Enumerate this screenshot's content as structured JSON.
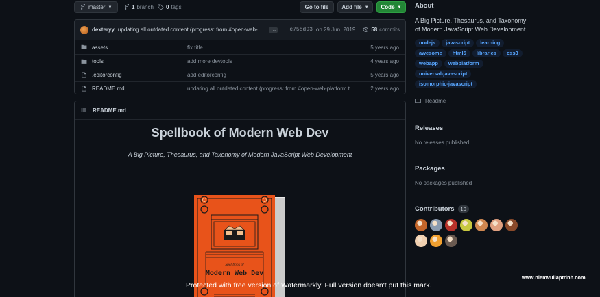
{
  "toolbar": {
    "branch": "master",
    "branch_count": "1",
    "branch_word": "branch",
    "tag_count": "0",
    "tag_word": "tags",
    "goto_file": "Go to file",
    "add_file": "Add file",
    "code": "Code"
  },
  "commit": {
    "author": "dexteryy",
    "message": "updating all outdated content (progress: from #open-web-platfo...",
    "ellipsis": "…",
    "sha": "e758d93",
    "date": "on 29 Jun, 2019",
    "count": "58",
    "count_label": "commits"
  },
  "files": [
    {
      "name": "assets",
      "type": "folder",
      "message": "fix title",
      "age": "5 years ago"
    },
    {
      "name": "tools",
      "type": "folder",
      "message": "add more devtools",
      "age": "4 years ago"
    },
    {
      "name": ".editorconfig",
      "type": "file",
      "message": "add editorconfig",
      "age": "5 years ago"
    },
    {
      "name": "README.md",
      "type": "file",
      "message": "updating all outdated content (progress: from #open-web-platform t...",
      "age": "2 years ago"
    }
  ],
  "readme": {
    "filename": "README.md",
    "heading": "Spellbook of Modern Web Dev",
    "subtitle": "A Big Picture, Thesaurus, and Taxonomy of Modern JavaScript Web Development",
    "book_small": "Spellbook of",
    "book_title": "Modern Web Dev"
  },
  "about": {
    "heading": "About",
    "description": "A Big Picture, Thesaurus, and Taxonomy of Modern JavaScript Web Development",
    "topics": [
      "nodejs",
      "javascript",
      "learning",
      "awesome",
      "html5",
      "libraries",
      "css3",
      "webapp",
      "webplatform",
      "universal-javascript",
      "isomorphic-javascript"
    ],
    "readme_link": "Readme"
  },
  "releases": {
    "heading": "Releases",
    "empty": "No releases published"
  },
  "packages": {
    "heading": "Packages",
    "empty": "No packages published"
  },
  "contributors": {
    "heading": "Contributors",
    "count": "10",
    "avatar_colors": [
      "#c4662a",
      "#8a9bb0",
      "#b8322a",
      "#c8c840",
      "#d08850",
      "#e0a080",
      "#8a4a2a",
      "#f0d0b0",
      "#f0a030",
      "#6a5a50"
    ]
  },
  "watermark": "Protected with free version of Watermarkly. Full version doesn't put this mark.",
  "site_mark": "www.niemvuilaptrinh.com",
  "colors": {
    "accent": "#58a6ff",
    "code_button": "#238636",
    "book": "#e8531a"
  }
}
